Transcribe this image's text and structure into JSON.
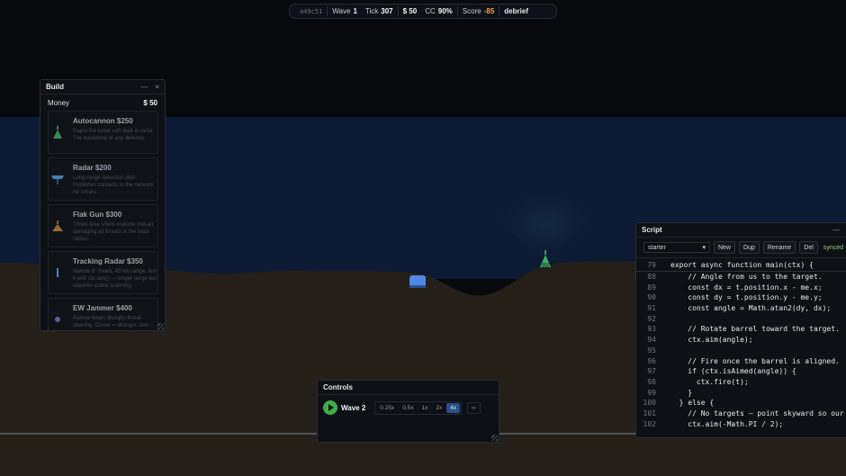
{
  "hud": {
    "seed": "a49c51",
    "wave_label": "Wave",
    "wave_value": "1",
    "tick_label": "Tick",
    "tick_value": "307",
    "money": "$ 50",
    "cc_label": "CC",
    "cc_value": "90%",
    "score_label": "Score",
    "score_value": "-85",
    "debrief": "debrief"
  },
  "build": {
    "title": "Build",
    "minimize": "—",
    "close": "×",
    "money_label": "Money",
    "money_value": "$ 50",
    "items": [
      {
        "name": "Autocannon $250",
        "desc": "Rapid-fire turret with built-in radar. The backbone of any defense.",
        "icon": "autocannon-icon"
      },
      {
        "name": "Radar $200",
        "desc": "Long-range detection dish. Publishes contacts to the network for turrets.",
        "icon": "radar-dish-icon"
      },
      {
        "name": "Flak Gun $300",
        "desc": "Timed-fuse shells explode mid-air, damaging all threats in the blast radius.",
        "icon": "flak-gun-icon"
      },
      {
        "name": "Tracking Radar $350",
        "desc": "Narrow 6° beam, 45 km range. Aim it with ctx.aim() — longer range but requires active scanning.",
        "icon": "tracking-radar-icon"
      },
      {
        "name": "EW Jammer $400",
        "desc": "Narrow beam disrupts threat steering. Closer = stronger. Aim with ctx.aim(). No...",
        "icon": "jammer-icon"
      }
    ]
  },
  "script": {
    "title": "Script",
    "minimize": "—",
    "selected": "starter",
    "buttons": {
      "new": "New",
      "dup": "Dup",
      "rename": "Rename",
      "del": "Del"
    },
    "synced": "synced",
    "lines": [
      {
        "n": "79",
        "code": "export async function main(ctx) {"
      },
      {
        "n": "88",
        "code": "    // Angle from us to the target."
      },
      {
        "n": "89",
        "code": "    const dx = t.position.x - me.x;"
      },
      {
        "n": "90",
        "code": "    const dy = t.position.y - me.y;"
      },
      {
        "n": "91",
        "code": "    const angle = Math.atan2(dy, dx);"
      },
      {
        "n": "92",
        "code": ""
      },
      {
        "n": "93",
        "code": "    // Rotate barrel toward the target."
      },
      {
        "n": "94",
        "code": "    ctx.aim(angle);"
      },
      {
        "n": "95",
        "code": ""
      },
      {
        "n": "96",
        "code": "    // Fire once the barrel is aligned."
      },
      {
        "n": "97",
        "code": "    if (ctx.isAimed(angle)) {"
      },
      {
        "n": "98",
        "code": "      ctx.fire(t);"
      },
      {
        "n": "99",
        "code": "    }"
      },
      {
        "n": "100",
        "code": "  } else {"
      },
      {
        "n": "101",
        "code": "    // No targets — point skyward so our"
      },
      {
        "n": "102",
        "code": "    ctx.aim(-Math.PI / 2);"
      }
    ]
  },
  "controls": {
    "title": "Controls",
    "wave": "Wave 2",
    "speeds": [
      "0.25x",
      "0.5x",
      "1x",
      "2x",
      "4x"
    ],
    "active_speed": "4x",
    "max_speed": "∞"
  },
  "colors": {
    "sky": "#07090d",
    "night_band": "#0c1a33",
    "ground": "#241f19",
    "accent_blue": "#2c4e86",
    "play_green": "#3fae4a",
    "score_negative": "#f0a548",
    "synced_green": "#8fd36b"
  }
}
